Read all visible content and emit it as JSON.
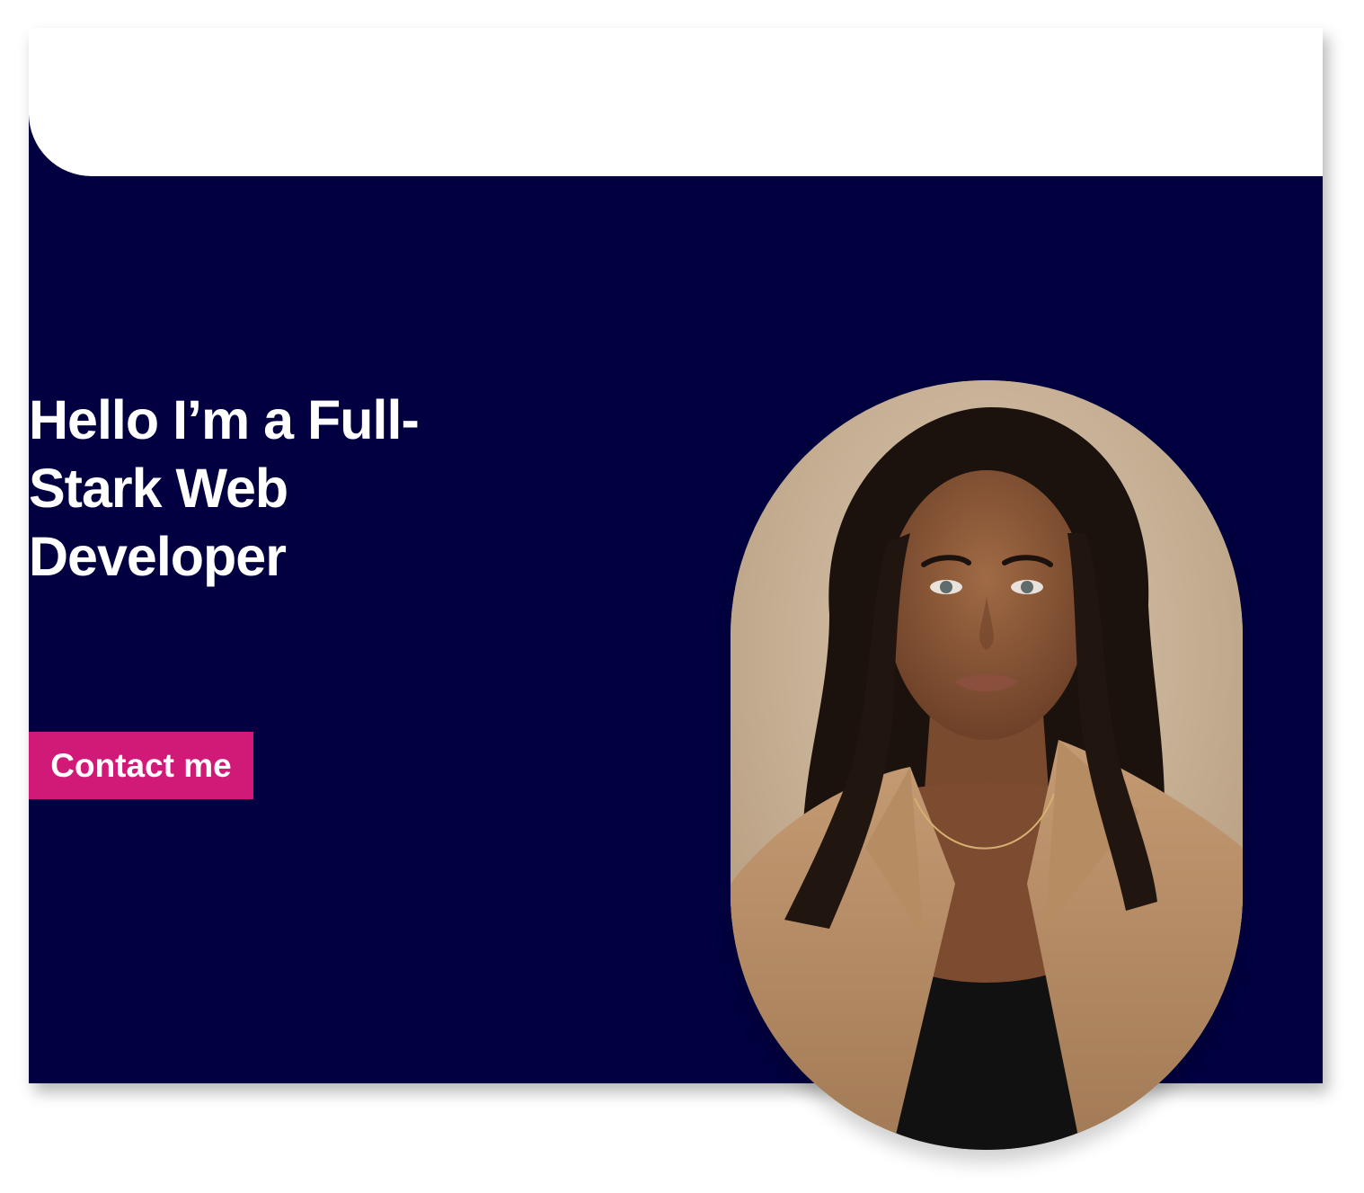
{
  "hero": {
    "headline": "Hello I’m a Full-Stark Web Developer",
    "cta_label": "Contact me"
  },
  "colors": {
    "background": "#020040",
    "header": "#ffffff",
    "accent": "#d11a78",
    "text": "#ffffff"
  },
  "portrait": {
    "icon": "profile-photo"
  }
}
